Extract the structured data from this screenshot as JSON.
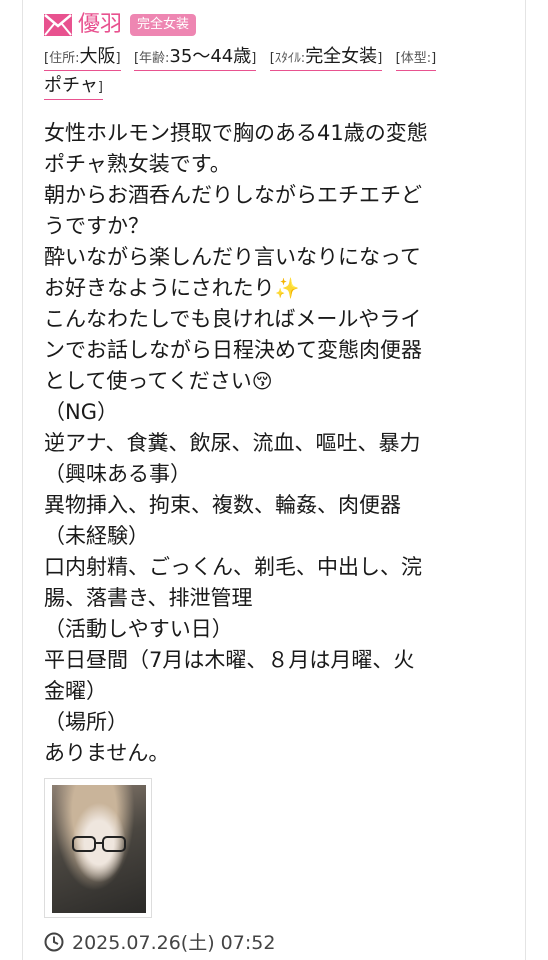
{
  "profile": {
    "name": "優羽",
    "badge": "完全女装",
    "tags": [
      {
        "key": "住所:",
        "value": "大阪"
      },
      {
        "key": "年齢:",
        "value": "35〜44歳"
      },
      {
        "key": "ｽﾀｲﾙ:",
        "value": "完全女装"
      },
      {
        "key": "体型:",
        "value": "ポチャ"
      }
    ]
  },
  "post": {
    "lines": [
      "女性ホルモン摂取で胸のある41歳の変態",
      "ポチャ熟女装です。",
      "朝からお酒呑んだりしながらエチエチど",
      "うですか？",
      "酔いながら楽しんだり言いなりになって",
      "お好きなようにされたり",
      "こんなわたしでも良ければメールやライ",
      "ンでお話しながら日程決めて変態肉便器",
      "として使ってください",
      "（NG）",
      "逆アナ、食糞、飲尿、流血、嘔吐、暴力",
      "（興味ある事）",
      "異物挿入、拘束、複数、輪姦、肉便器",
      "（未経験）",
      "口内射精、ごっくん、剃毛、中出し、浣",
      "腸、落書き、排泄管理",
      "（活動しやすい日）",
      "平日昼間（7月は木曜、８月は月曜、火",
      "金曜）",
      "（場所）",
      "ありません。"
    ],
    "emoji_sparkles": "✨",
    "emoji_kiss": "😚",
    "timestamp": "2025.07.26(土) 07:52"
  },
  "icons": {
    "mail": "mail-icon",
    "clock": "clock-icon"
  },
  "colors": {
    "accent": "#e8528f",
    "badge_bg": "#ee86b2"
  }
}
